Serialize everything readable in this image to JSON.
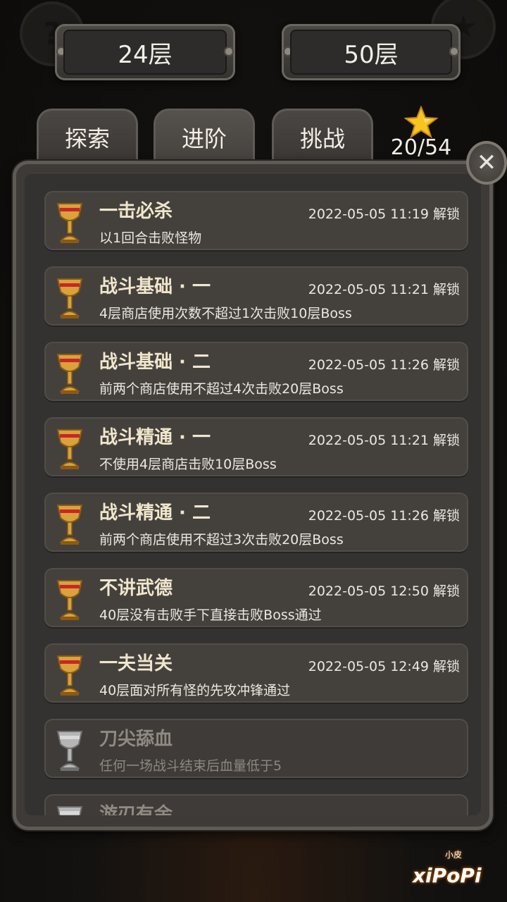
{
  "header": {
    "current_floor": "24层",
    "max_floor": "50层"
  },
  "tabs": [
    {
      "label": "探索"
    },
    {
      "label": "进阶"
    },
    {
      "label": "挑战"
    }
  ],
  "stars": {
    "count": "20/54"
  },
  "corner_icons": {
    "left": "?",
    "right": "★"
  },
  "close_label": "✕",
  "achievements": [
    {
      "title": "一击必杀",
      "date": "2022-05-05 11:19 解锁",
      "desc": "以1回合击败怪物",
      "unlocked": true
    },
    {
      "title": "战斗基础 · 一",
      "date": "2022-05-05 11:21 解锁",
      "desc": "4层商店使用次数不超过1次击败10层Boss",
      "unlocked": true
    },
    {
      "title": "战斗基础 · 二",
      "date": "2022-05-05 11:26 解锁",
      "desc": "前两个商店使用不超过4次击败20层Boss",
      "unlocked": true
    },
    {
      "title": "战斗精通 · 一",
      "date": "2022-05-05 11:21 解锁",
      "desc": "不使用4层商店击败10层Boss",
      "unlocked": true
    },
    {
      "title": "战斗精通 · 二",
      "date": "2022-05-05 11:26 解锁",
      "desc": "前两个商店使用不超过3次击败20层Boss",
      "unlocked": true
    },
    {
      "title": "不讲武德",
      "date": "2022-05-05 12:50 解锁",
      "desc": "40层没有击败手下直接击败Boss通过",
      "unlocked": true
    },
    {
      "title": "一夫当关",
      "date": "2022-05-05 12:49 解锁",
      "desc": "40层面对所有怪的先攻冲锋通过",
      "unlocked": true
    },
    {
      "title": "刀尖舔血",
      "date": "",
      "desc": "任何一场战斗结束后血量低于5",
      "unlocked": false
    },
    {
      "title": "游刃有余",
      "date": "",
      "desc": "",
      "unlocked": false
    }
  ],
  "watermark": {
    "text": "xiPoPi",
    "small": "小皮"
  },
  "colors": {
    "trophy_gold": "#d9a23a",
    "trophy_gem": "#c8262a",
    "trophy_silver": "#b5b5b5",
    "panel": "#3d3a37"
  }
}
